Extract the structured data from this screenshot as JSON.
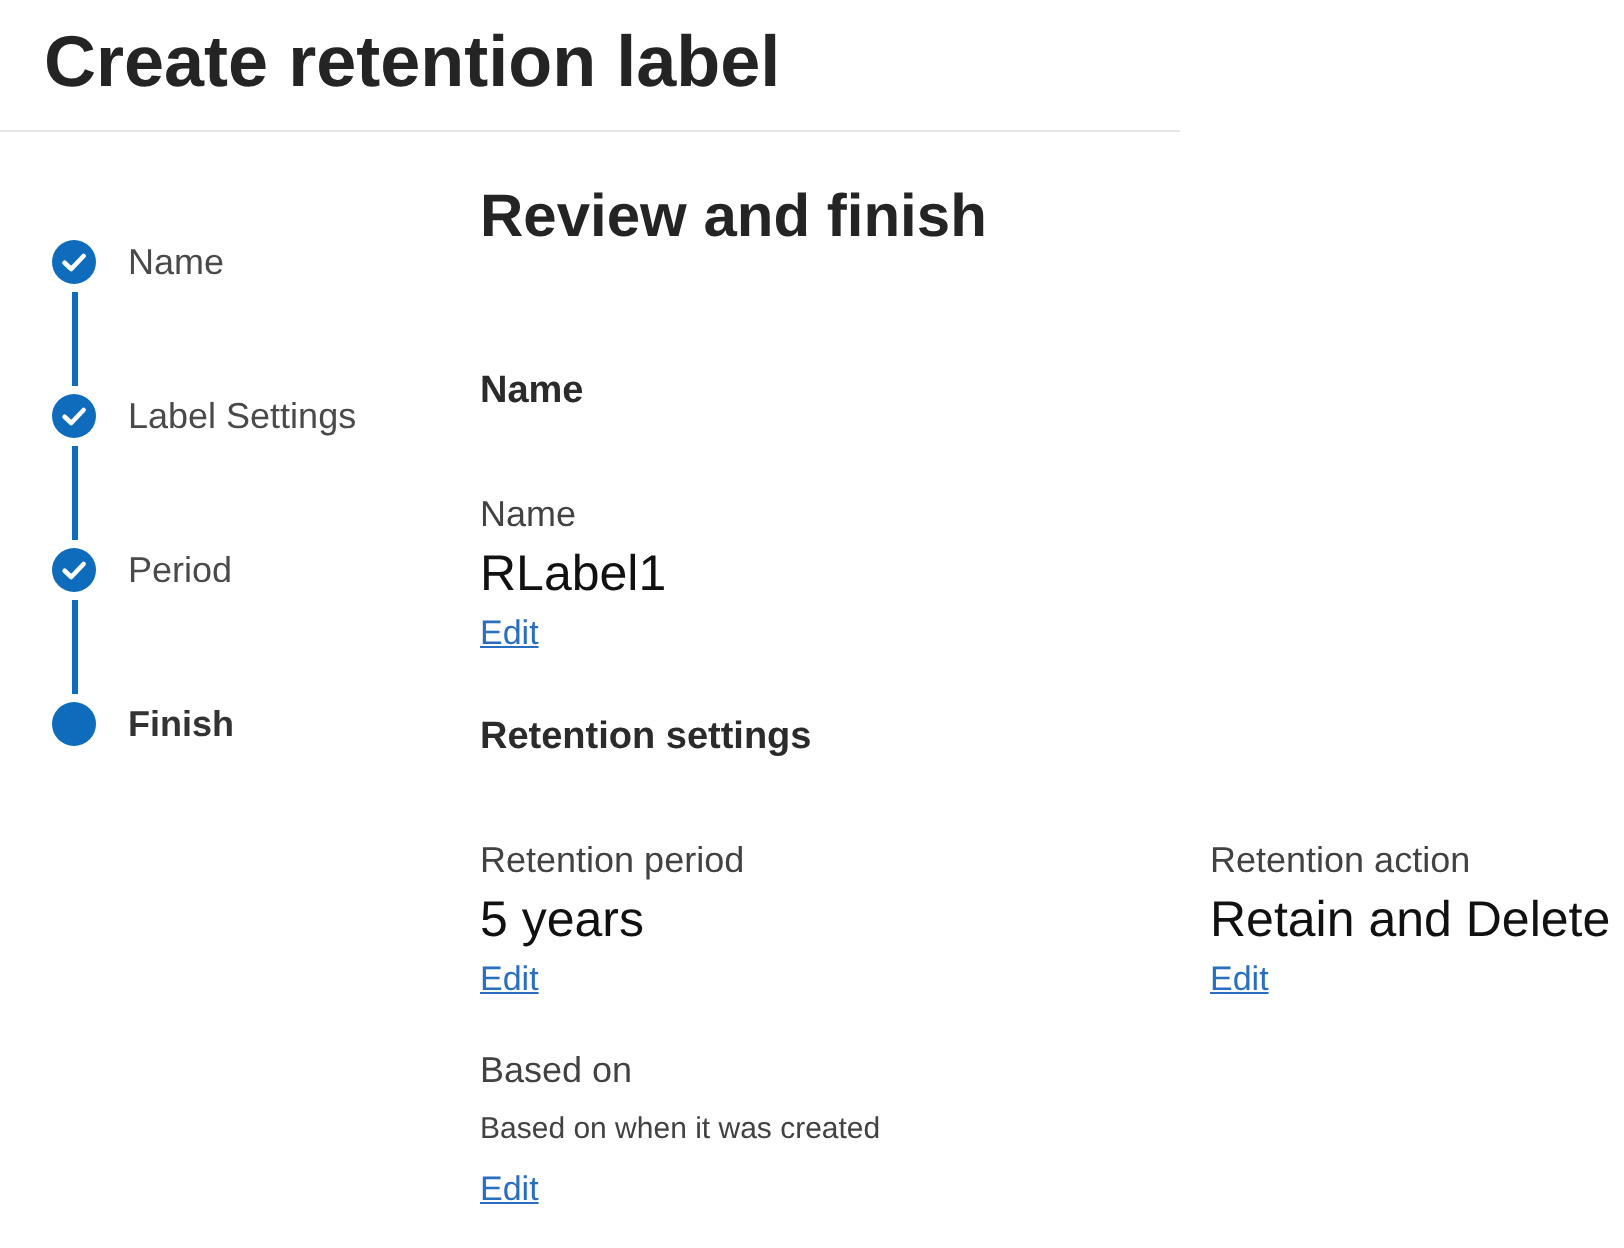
{
  "page": {
    "title": "Create retention label"
  },
  "steps": [
    {
      "label": "Name",
      "completed": true,
      "selected": false
    },
    {
      "label": "Label Settings",
      "completed": true,
      "selected": false
    },
    {
      "label": "Period",
      "completed": true,
      "selected": false
    },
    {
      "label": "Finish",
      "completed": false,
      "selected": true
    }
  ],
  "review": {
    "heading": "Review and finish",
    "sections": [
      {
        "heading": "Name",
        "columns": [
          {
            "fields": [
              {
                "kind": "primary",
                "label": "Name",
                "value": "RLabel1",
                "link": "Edit"
              }
            ]
          }
        ]
      },
      {
        "heading": "Retention settings",
        "columns": [
          {
            "fields": [
              {
                "kind": "primary",
                "label": "Retention period",
                "value": "5 years",
                "link": "Edit"
              },
              {
                "kind": "secondary",
                "label": "Based on",
                "value": "Based on when it was created",
                "link": "Edit"
              }
            ]
          },
          {
            "fields": [
              {
                "kind": "primary",
                "label": "Retention action",
                "value": "Retain and Delete",
                "link": "Edit"
              }
            ]
          }
        ]
      }
    ]
  }
}
